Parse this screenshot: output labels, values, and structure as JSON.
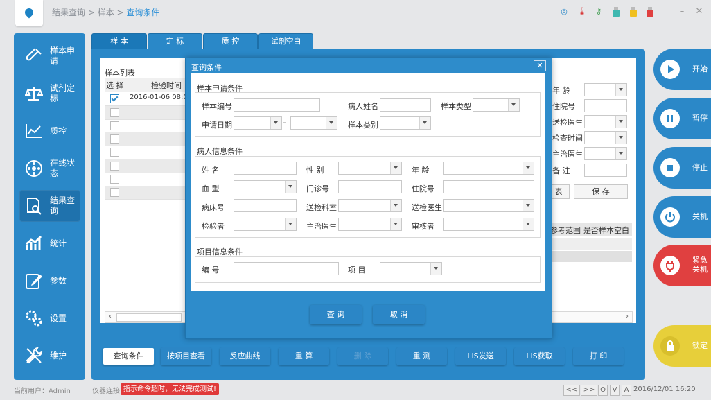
{
  "breadcrumb": {
    "a": "结果查询",
    "sep1": " > ",
    "b": "样本",
    "sep2": " > ",
    "c": "查询条件"
  },
  "sidebar": [
    {
      "label": "样本申请",
      "icon": "test-tube-icon"
    },
    {
      "label": "试剂定标",
      "icon": "balance-scale-icon"
    },
    {
      "label": "质控",
      "icon": "line-chart-icon"
    },
    {
      "label": "在线状态",
      "icon": "wheel-icon"
    },
    {
      "label": "结果查询",
      "icon": "document-search-icon"
    },
    {
      "label": "统计",
      "icon": "bar-chart-icon"
    },
    {
      "label": "参数",
      "icon": "edit-icon"
    },
    {
      "label": "设置",
      "icon": "gears-icon"
    },
    {
      "label": "维护",
      "icon": "tools-icon"
    }
  ],
  "tabs": [
    "样 本",
    "定 标",
    "质 控",
    "试剂空白"
  ],
  "sample_list": {
    "title": "样本列表",
    "col_select": "选 择",
    "col_time": "检验时间",
    "row1_time": "2016-01-06  08:0"
  },
  "right_fields": {
    "age": "年 龄",
    "hospital_no": "住院号",
    "send_doctor": "送检医生",
    "check_time": "检查时间",
    "main_doctor": "主治医生",
    "remark": "备 注",
    "btn_partial": "表",
    "btn_save": "保 存",
    "col_ref": "参考范围",
    "col_blank": "是否样本空白"
  },
  "bottom_buttons": [
    "查询条件",
    "按项目查看",
    "反应曲线",
    "重 算",
    "删 除",
    "重 测",
    "LIS发送",
    "LIS获取",
    "打 印"
  ],
  "right_controls": [
    {
      "label": "开始",
      "color": "#2b88c8",
      "icon": "play-icon"
    },
    {
      "label": "暂停",
      "color": "#2b88c8",
      "icon": "pause-icon"
    },
    {
      "label": "停止",
      "color": "#2b88c8",
      "icon": "stop-icon"
    },
    {
      "label": "关机",
      "color": "#2b88c8",
      "icon": "power-icon"
    },
    {
      "label": "紧急关机",
      "color": "#e04040",
      "icon": "plug-icon"
    },
    {
      "label": "锁定",
      "color": "#e7cf3a",
      "icon": "lock-icon"
    }
  ],
  "status": {
    "current_user": "当前用户：Admin",
    "connection": "仪器连接",
    "warning": "指示命令超时，无法完成测试!",
    "nav": [
      "<<",
      ">>",
      "O",
      "V",
      "A"
    ],
    "datetime": "2016/12/01 16:20"
  },
  "dialog": {
    "title": "查询条件",
    "close": "✕",
    "group1": {
      "title": "样本申请条件",
      "sample_no": "样本编号",
      "patient_name": "病人姓名",
      "sample_type": "样本类型",
      "apply_date": "申请日期",
      "dash": "–",
      "sample_category": "样本类别"
    },
    "group2": {
      "title": "病人信息条件",
      "name": "姓 名",
      "gender": "性 别",
      "age": "年 龄",
      "blood": "血 型",
      "outpatient": "门诊号",
      "inpatient": "住院号",
      "bed": "病床号",
      "send_dept": "送检科室",
      "send_doctor": "送检医生",
      "tester": "检验者",
      "main_doctor": "主治医生",
      "reviewer": "审核者"
    },
    "group3": {
      "title": "项目信息条件",
      "code": "编 号",
      "item": "项 目"
    },
    "btn_query": "查 询",
    "btn_cancel": "取 消"
  },
  "colors": {
    "primary": "#2a88c8",
    "warning": "#e03a3a",
    "emergency": "#e04040",
    "lock": "#e7cf3a"
  }
}
